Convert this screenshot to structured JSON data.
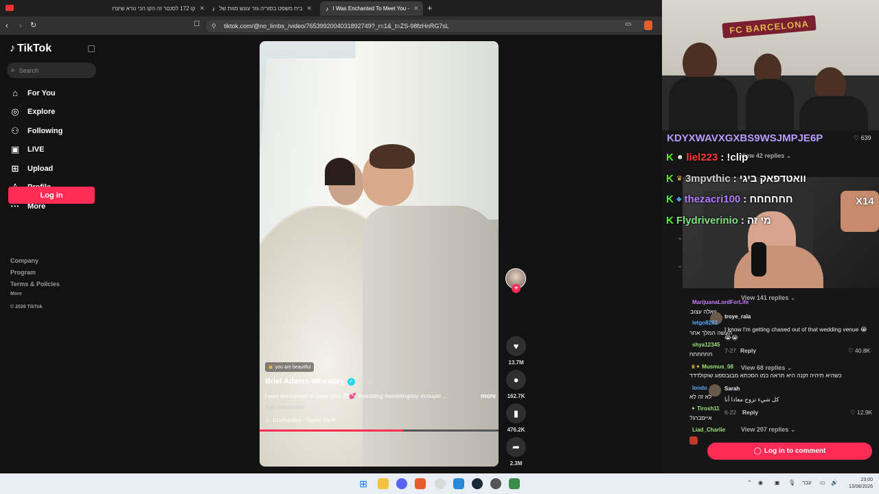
{
  "browser": {
    "tabs": [
      {
        "title": "קו 172 לסנטר זה הקו הכי נורא שיצרו"
      },
      {
        "title": "בית משפט בסוריה גזר עונש מוות של"
      },
      {
        "title": "I Was Enchanted To Meet You -"
      }
    ],
    "url": "tiktok.com/@no_limbs_/video/7653992004031892749?_r=1&_t=ZS-98fzHnRG7sL"
  },
  "sidebar": {
    "logo": "TikTok",
    "search_placeholder": "Search",
    "nav": [
      {
        "label": "For You",
        "icon": "home-icon"
      },
      {
        "label": "Explore",
        "icon": "compass-icon"
      },
      {
        "label": "Following",
        "icon": "following-icon"
      },
      {
        "label": "LIVE",
        "icon": "live-icon"
      },
      {
        "label": "Upload",
        "icon": "upload-icon"
      },
      {
        "label": "Profile",
        "icon": "profile-icon"
      },
      {
        "label": "More",
        "icon": "more-icon"
      }
    ],
    "login_label": "Log in",
    "footer": [
      "Company",
      "Program",
      "Terms & Policies"
    ],
    "footer_more": "More",
    "copyright": "© 2026 TikTok"
  },
  "video": {
    "sticker": "you are beautiful",
    "author": "Briel Adams-Wheatley",
    "date": "· 6-22",
    "description": "I was enchanted to meet you! 😍💕 #wedding #weddingday #couple ...",
    "more": "more",
    "see_translation": "See translation",
    "music": "Enchanted - Taylor Swift",
    "progress": 0.6
  },
  "actions": {
    "likes": "13.7M",
    "comments": "162.7K",
    "saves": "476.2K",
    "shares": "2.3M"
  },
  "stream": {
    "scarf_text": "FC BARCELONA",
    "x14": "X14",
    "hex_user": "KDYXWAVXGXBS9WSJMPJE6P",
    "hex_likes": "639",
    "chat": [
      {
        "user": "liel223",
        "msg": ": !clip",
        "color": "#ff3b3b"
      },
      {
        "user": "3mpvthic",
        "msg": ": וואטדפאק ביגי",
        "color": "#cfcfcf"
      },
      {
        "user": "thezacri100",
        "msg": ": חחחחחח",
        "color": "#b07bff"
      },
      {
        "user": "Flydriverinio",
        "msg": ": מי זה",
        "color": "#7ee07e"
      }
    ]
  },
  "comments": {
    "view_42": "View 42 replies",
    "view_141": "View 141 replies",
    "view_68": "View 68 replies",
    "view_207": "View 207 replies",
    "overlay_users": [
      {
        "user": "MarijuanaLordForLife",
        "msg": "וואלה עצוב",
        "color": "#c77dff"
      },
      {
        "user": "letgo8282",
        "msg": "העשה המלך אחר",
        "color": "#5aa9ff"
      },
      {
        "user": "shya12345",
        "msg": "חחחחחח",
        "color": "#9be37a"
      },
      {
        "user": "Musmus_08",
        "msg": "כשהיא תיהיה זקנה היא תראה כמו הסכתא מבובספוג שוקולדדד",
        "color": "#9be37a"
      },
      {
        "user": "londo",
        "msg": "לא זה לא",
        "color": "#5aa9ff"
      },
      {
        "user": "Tirosh11",
        "msg": "?אייסברג",
        "color": "#9be37a"
      },
      {
        "user": "Liad_Charlie",
        "msg": "",
        "color": "#9be37a"
      }
    ],
    "c1_user": "troye_rala",
    "c1_text": "I know I'm getting chased out of that wedding venue 😭😭😭",
    "c1_date": "7-27",
    "c1_reply": "Reply",
    "c1_likes": "40.8K",
    "c2_user": "Sarah",
    "c2_text": "كل شيء تزوج معادا أنا",
    "c2_date": "6-22",
    "c2_reply": "Reply",
    "c2_likes": "12.9K",
    "login_comment": "Log in to comment"
  },
  "taskbar": {
    "lang": "עבר",
    "time": "23:00",
    "date": "13/08/2026"
  }
}
